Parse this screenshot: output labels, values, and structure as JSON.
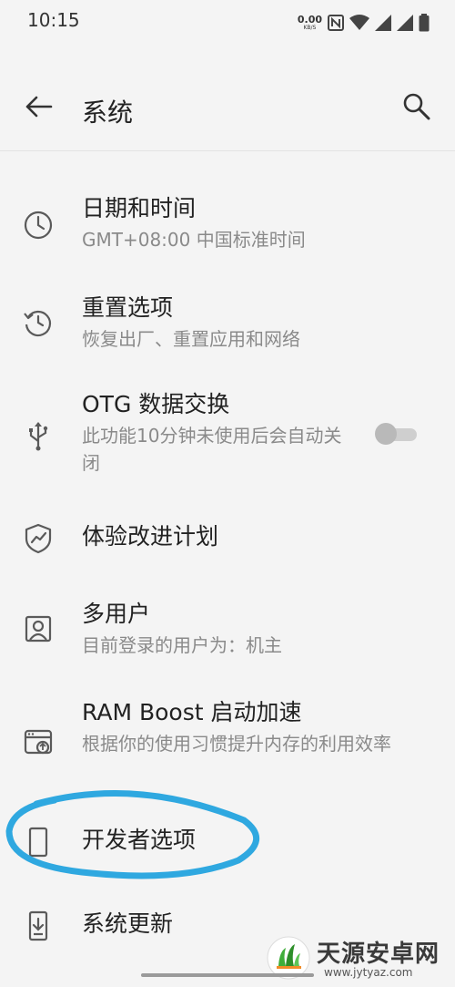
{
  "status_bar": {
    "time": "10:15",
    "net_speed_value": "0.00",
    "net_speed_unit": "KB/S",
    "icons": [
      "nfc-icon",
      "wifi-icon",
      "signal-icon",
      "signal-icon",
      "battery-icon"
    ]
  },
  "app_bar": {
    "title": "系统",
    "back_icon": "back-arrow-icon",
    "search_icon": "search-icon"
  },
  "settings": [
    {
      "icon": "clock-icon",
      "label": "日期和时间",
      "summary": "GMT+08:00 中国标准时间"
    },
    {
      "icon": "reset-icon",
      "label": "重置选项",
      "summary": "恢复出厂、重置应用和网络"
    },
    {
      "icon": "usb-icon",
      "label": "OTG 数据交换",
      "summary": "此功能10分钟未使用后会自动关闭",
      "toggle": false
    },
    {
      "icon": "shield-chart-icon",
      "label": "体验改进计划"
    },
    {
      "icon": "user-icon",
      "label": "多用户",
      "summary": "目前登录的用户为：机主"
    },
    {
      "icon": "ram-boost-icon",
      "label": "RAM Boost 启动加速",
      "summary": "根据你的使用习惯提升内存的利用效率"
    },
    {
      "icon": "phone-icon",
      "label": "开发者选项"
    },
    {
      "icon": "system-update-icon",
      "label": "系统更新"
    }
  ],
  "annotation": {
    "color": "#2fa8e0",
    "target": "开发者选项"
  },
  "watermark": {
    "name": "天源安卓网",
    "url": "www.jytyaz.com"
  },
  "colors": {
    "background": "#f4f4f4",
    "text_primary": "#222222",
    "text_secondary": "#8a8a8a",
    "icon": "#5a5a5a"
  }
}
